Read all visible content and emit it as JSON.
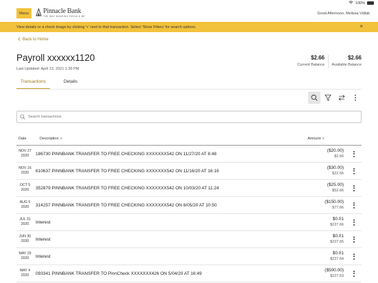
{
  "status": {
    "battery": "100%"
  },
  "header": {
    "menu_label": "Menu",
    "brand_name": "Pinnacle Bank",
    "brand_tagline": "THE WAY BANKING SHOULD BE",
    "greeting": "Good Afternoon, Melissa Vidlak"
  },
  "banner": {
    "text": "View details or a check image by clicking '+' next to that transaction. Select 'Show Filters' for search options.",
    "close": "×"
  },
  "back_label": "Back to Home",
  "account": {
    "title": "Payroll xxxxxx1120",
    "updated": "Last Updated: April 13, 2021 1:35 PM",
    "current_balance": "$2.66",
    "current_balance_label": "Current Balance",
    "available_balance": "$2.66",
    "available_balance_label": "Available Balance"
  },
  "tabs": [
    "Transactions",
    "Details"
  ],
  "search": {
    "placeholder": "Search transactions"
  },
  "table": {
    "headers": {
      "date": "Date",
      "description": "Description",
      "amount": "Amount"
    },
    "rows": [
      {
        "date_md": "NOV 27",
        "date_y": "2020",
        "desc": "186730 PINNBANK TRANSFER TO FREE CHECKING XXXXXXX542 ON 11/27/20 AT 8:48",
        "amount": "($20.00)",
        "balance": "$2.66"
      },
      {
        "date_md": "NOV 16",
        "date_y": "2020",
        "desc": "610637 PINNBANK TRANSFER TO FREE CHECKING XXXXXXX542 ON 11/16/20 AT 16:16",
        "amount": "($30.00)",
        "balance": "$22.66"
      },
      {
        "date_md": "OCT 5",
        "date_y": "2020",
        "desc": "352879 PINNBANK TRANSFER TO FREE CHECKING XXXXXXX542 ON 10/03/20 AT 11:24",
        "amount": "($25.00)",
        "balance": "$52.66"
      },
      {
        "date_md": "AUG 5",
        "date_y": "2020",
        "desc": "314257 PINNBANK TRANSFER TO FREE CHECKING XXXXXXX542 ON 8/05/20 AT 10:50",
        "amount": "($150.00)",
        "balance": "$77.66"
      },
      {
        "date_md": "JUL 31",
        "date_y": "2020",
        "desc": "Interest",
        "amount": "$0.01",
        "balance": "$227.66"
      },
      {
        "date_md": "JUN 30",
        "date_y": "2020",
        "desc": "Interest",
        "amount": "$0.01",
        "balance": "$227.65"
      },
      {
        "date_md": "MAY 29",
        "date_y": "2020",
        "desc": "Interest",
        "amount": "$0.01",
        "balance": "$227.64"
      },
      {
        "date_md": "MAY 4",
        "date_y": "2020",
        "desc": "093341 PINNBANK TRANSFER TO PinnCheck XXXXXXX426 ON 5/04/20 AT 16:49",
        "amount": "($500.00)",
        "balance": "$227.63"
      }
    ]
  },
  "colors": {
    "accent": "#f2c23c",
    "link": "#9a7a1c"
  }
}
